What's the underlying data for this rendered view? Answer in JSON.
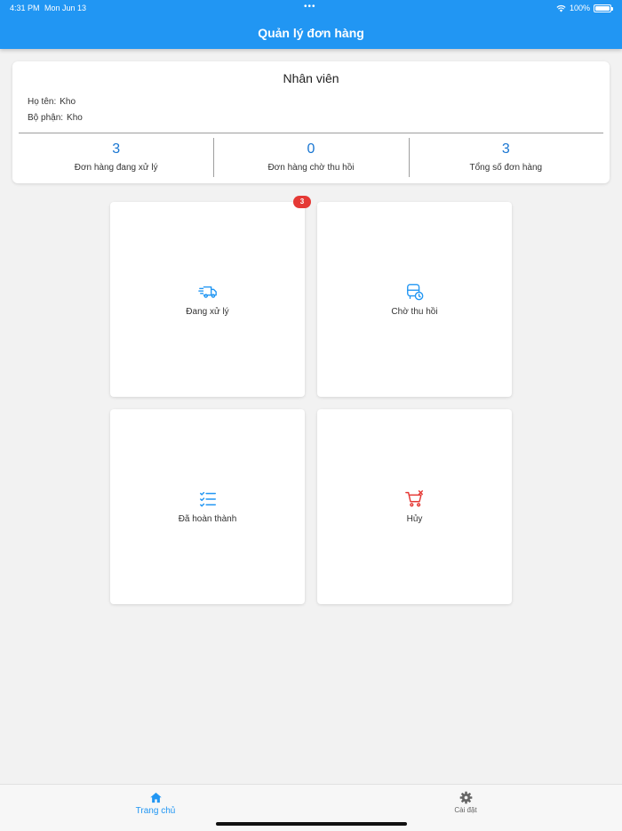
{
  "status_bar": {
    "time": "4:31 PM",
    "date": "Mon Jun 13",
    "dots": "•••",
    "battery": "100%"
  },
  "header": {
    "title": "Quản lý đơn hàng"
  },
  "employee": {
    "title": "Nhân viên",
    "name_label": "Họ tên:",
    "name_value": "Kho",
    "dept_label": "Bộ phận:",
    "dept_value": "Kho",
    "stats": [
      {
        "value": "3",
        "label": "Đơn hàng đang xử lý"
      },
      {
        "value": "0",
        "label": "Đơn hàng chờ thu hồi"
      },
      {
        "value": "3",
        "label": "Tổng số đơn hàng"
      }
    ]
  },
  "tiles": {
    "processing": {
      "label": "Đang xử lý",
      "icon": "delivery-truck-icon",
      "badge": "3"
    },
    "waiting": {
      "label": "Chờ thu hồi",
      "icon": "bus-clock-icon"
    },
    "completed": {
      "label": "Đã hoàn thành",
      "icon": "checklist-icon"
    },
    "cancel": {
      "label": "Hủy",
      "icon": "cart-cancel-icon"
    }
  },
  "bottom_nav": {
    "home": "Trang chủ",
    "settings": "Cài đặt"
  },
  "colors": {
    "primary": "#2196f3",
    "stat_value": "#1976d2",
    "cancel_red": "#e53935",
    "background": "#f2f2f2"
  }
}
